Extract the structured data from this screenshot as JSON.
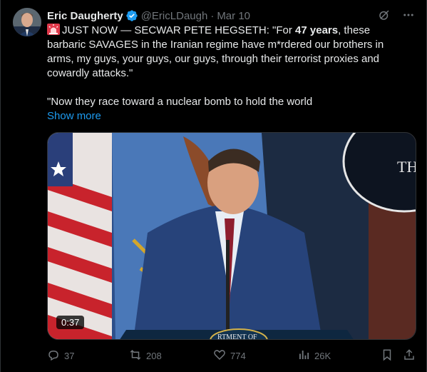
{
  "author": {
    "name": "Eric Daugherty",
    "handle": "@EricLDaugh",
    "date": "Mar 10"
  },
  "post": {
    "line1_prefix": "JUST NOW — SECWAR PETE HEGSETH: \"For ",
    "line1_bold": "47 years",
    "line1_suffix": ", these barbaric SAVAGES in the Iranian regime have m*rdered our brothers in arms, my guys, your guys, our guys, through their terrorist proxies and cowardly attacks.\"",
    "line2": "\"Now they race toward a nuclear bomb to hold the world",
    "show_more": "Show more",
    "siren_icon": "rotating-light-icon"
  },
  "media": {
    "duration": "0:37",
    "sign_text": "TH",
    "seal_text": "RTMENT OF"
  },
  "actions": {
    "replies": "37",
    "reposts": "208",
    "likes": "774",
    "views": "26K"
  },
  "colors": {
    "accent": "#1d9bf0",
    "muted": "#71767b",
    "text": "#e7e9ea",
    "background": "#000000"
  }
}
